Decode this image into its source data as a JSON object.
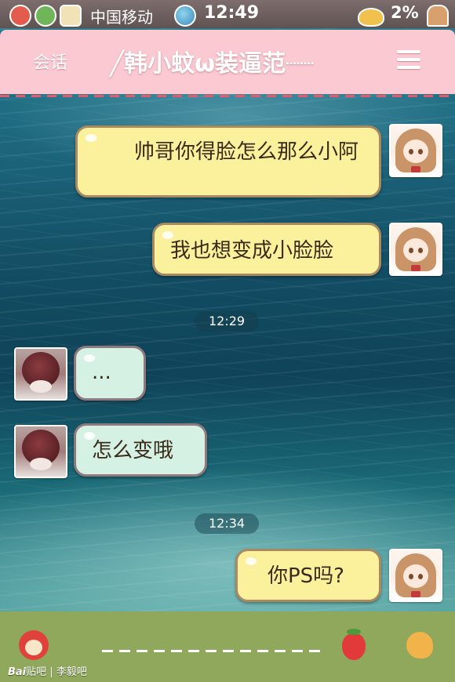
{
  "status_bar": {
    "carrier": "中国移动",
    "time": "12:49",
    "battery": "2%"
  },
  "nav": {
    "back_label": "会话",
    "title": "╱韩小蚊ω装逼范┈┈"
  },
  "messages": [
    {
      "side": "me",
      "text": "　　帅哥你得脸怎么那么小阿"
    },
    {
      "side": "me",
      "text": "我也想变成小脸脸"
    },
    {
      "timestamp": "12:29"
    },
    {
      "side": "other",
      "text": "..."
    },
    {
      "side": "other",
      "text": "怎么变哦"
    },
    {
      "timestamp": "12:34"
    },
    {
      "side": "me",
      "text": "你PS吗?"
    }
  ],
  "watermark": {
    "brand": "Bai",
    "product": "贴吧",
    "author": "李毅吧"
  },
  "icons": {
    "status_left": [
      "girl-icon",
      "tree-icon",
      "cake-icon"
    ],
    "status_globe": "globe-icon",
    "status_right": [
      "ufo-icon",
      "ice-cream-icon"
    ],
    "bottom": [
      "girl-icon",
      "strawberry-icon",
      "cone-icon"
    ]
  },
  "colors": {
    "nav_bg": "#fbc9d2",
    "bubble_me": "#fbf19c",
    "bubble_other": "#d5f1e3",
    "bottom_bar": "#8fa85c"
  }
}
